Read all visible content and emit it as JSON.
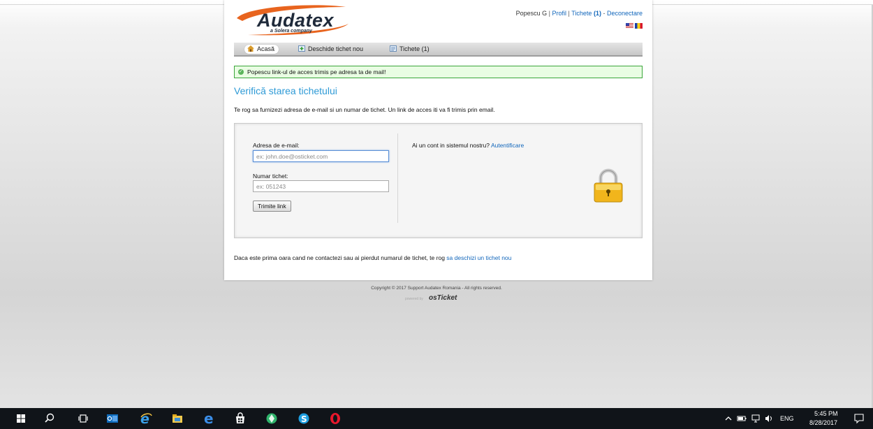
{
  "brand": {
    "name": "Audatex",
    "tagline": "a Solera company"
  },
  "user_nav": {
    "user": "Popescu G",
    "profile": "Profil",
    "tickets": "Tichete",
    "tickets_count": "(1)",
    "logout": "Deconectare"
  },
  "nav": {
    "home": "Acasă",
    "new_ticket": "Deschide tichet nou",
    "tickets": "Tichete (1)"
  },
  "notice": "Popescu  link-ul de acces trimis pe adresa ta de mail!",
  "page_title": "Verifică starea tichetului",
  "intro": "Te rog sa furnizezi adresa de e-mail si un numar de tichet. Un link de acces iti va fi trimis prin email.",
  "form": {
    "email_label": "Adresa de e-mail:",
    "email_placeholder": "ex: john.doe@osticket.com",
    "ticket_label": "Numar tichet:",
    "ticket_placeholder": "ex: 051243",
    "submit": "Trimite link"
  },
  "account": {
    "question": "Ai un cont in sistemul nostru?",
    "login_link": "Autentificare"
  },
  "footer_note": {
    "text": "Daca este prima oara cand ne contactezi sau ai pierdut numarul de tichet, te rog",
    "link": "sa deschizi un tichet nou"
  },
  "copyright": "Copyright © 2017 Support Audatex Romania - All rights reserved.",
  "powered": {
    "by": "powered by",
    "brand": "osTicket"
  },
  "taskbar": {
    "icons": [
      "windows-start-icon",
      "search-icon",
      "task-view-icon",
      "outlook-icon",
      "internet-explorer-icon",
      "file-explorer-icon",
      "edge-icon",
      "store-icon",
      "app-icon",
      "skype-icon",
      "opera-icon"
    ],
    "language": "ENG",
    "time": "5:45 PM",
    "date": "8/28/2017"
  },
  "colors": {
    "link": "#1166bb",
    "title": "#2e9ad6",
    "notice_bg": "#e9fde3",
    "notice_border": "#3aa63a",
    "brand_orange": "#e8641e"
  }
}
